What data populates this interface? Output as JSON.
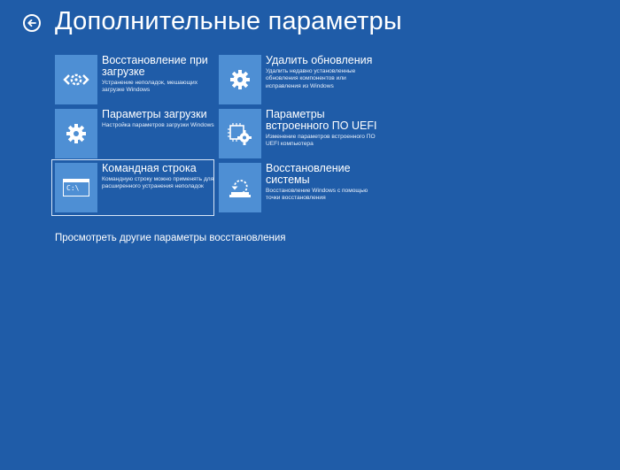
{
  "header": {
    "title": "Дополнительные параметры"
  },
  "tiles": [
    {
      "title": "Восстановление при\nзагрузке",
      "desc": "Устранение неполадок, мешающих загрузке Windows",
      "icon": "startup-repair-icon"
    },
    {
      "title": "Удалить обновления",
      "desc": "Удалить недавно установленные обновления компонентов или исправления из Windows",
      "icon": "gear-icon"
    },
    {
      "title": "Параметры загрузки",
      "desc": "Настройка параметров загрузки Windows",
      "icon": "gear-icon"
    },
    {
      "title": "Параметры\nвстроенного ПО UEFI",
      "desc": "Изменение параметров встроенного ПО UEFI компьютера",
      "icon": "uefi-chip-gear-icon"
    },
    {
      "title": "Командная строка",
      "desc": "Командную строку можно применять для расширенного устранения неполадок",
      "icon": "command-prompt-icon",
      "icon_text": "C:\\"
    },
    {
      "title": "Восстановление\nсистемы",
      "desc": "Восстановление Windows с помощью точки восстановления",
      "icon": "system-restore-icon"
    }
  ],
  "more_link": "Просмотреть другие параметры восстановления",
  "colors": {
    "background": "#1f5ca8",
    "tile_icon_bg": "#4e8fd4",
    "text": "#ffffff"
  }
}
